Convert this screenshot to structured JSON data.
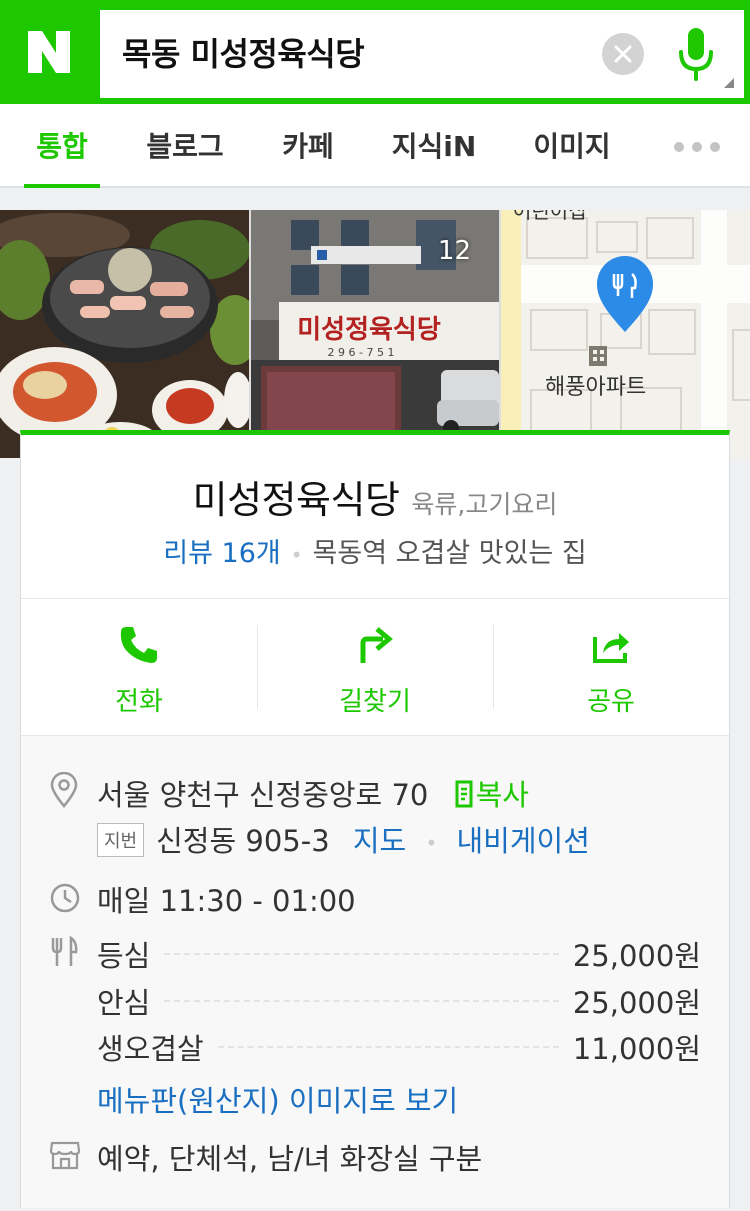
{
  "search": {
    "logo": "N",
    "query": "목동 미성정육식당"
  },
  "tabs": [
    {
      "label": "통합",
      "active": true
    },
    {
      "label": "블로그",
      "active": false
    },
    {
      "label": "카페",
      "active": false
    },
    {
      "label": "지식iN",
      "active": false
    },
    {
      "label": "이미지",
      "active": false
    }
  ],
  "photos": {
    "count": "12",
    "map_labels": [
      "어린이집",
      "해풍아파트"
    ]
  },
  "place": {
    "name": "미성정육식당",
    "category": "육류,고기요리",
    "review": "리뷰 16개",
    "description": "목동역 오겹살 맛있는 집"
  },
  "actions": [
    {
      "label": "전화",
      "icon": "phone-icon"
    },
    {
      "label": "길찾기",
      "icon": "directions-icon"
    },
    {
      "label": "공유",
      "icon": "share-icon"
    }
  ],
  "info": {
    "address": "서울 양천구 신정중앙로 70",
    "copy": "복사",
    "jibun_badge": "지번",
    "jibun": "신정동 905-3",
    "map_link": "지도",
    "navi_link": "내비게이션",
    "hours": "매일 11:30 - 01:00",
    "menu": [
      {
        "name": "등심",
        "price": "25,000원"
      },
      {
        "name": "안심",
        "price": "25,000원"
      },
      {
        "name": "생오겹살",
        "price": "11,000원"
      }
    ],
    "menu_link": "메뉴판(원산지) 이미지로 보기",
    "facilities": "예약, 단체석, 남/녀 화장실 구분"
  },
  "colors": {
    "brand": "#1ec800",
    "link": "#1a6fc1"
  }
}
